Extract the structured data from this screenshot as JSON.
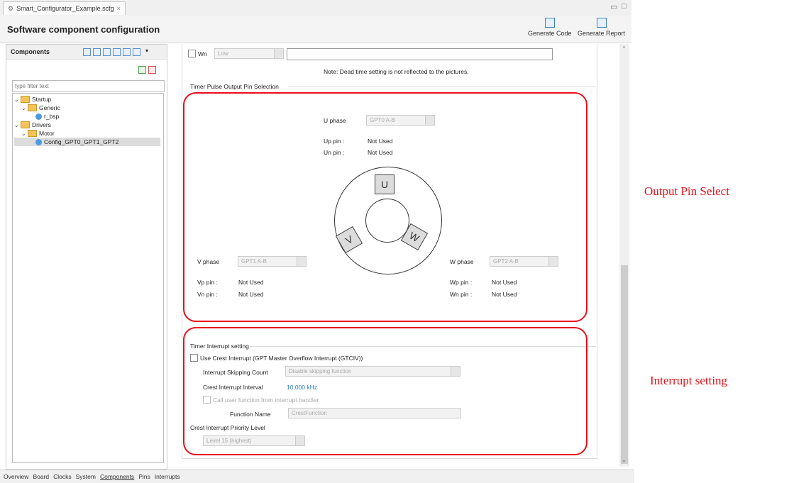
{
  "editor": {
    "tab_label": "Smart_Configurator_Example.scfg",
    "tab_close": "×",
    "page_title": "Software component configuration",
    "generate_code": "Generate Code",
    "generate_report": "Generate Report"
  },
  "components_panel": {
    "title": "Components",
    "filter_placeholder": "type filter text",
    "tree": [
      {
        "label": "Startup",
        "kind": "folder",
        "level": 0
      },
      {
        "label": "Generic",
        "kind": "folder",
        "level": 1
      },
      {
        "label": "r_bsp",
        "kind": "component",
        "level": 2
      },
      {
        "label": "Drivers",
        "kind": "folder",
        "level": 0
      },
      {
        "label": "Motor",
        "kind": "folder",
        "level": 1
      },
      {
        "label": "Config_GPT0_GPT1_GPT2",
        "kind": "component",
        "level": 2,
        "selected": true
      }
    ]
  },
  "deadtime": {
    "wn_label": "Wn",
    "wn_value": "Low",
    "note": "Note: Dead time setting is not reflected to the pictures."
  },
  "pin_selection": {
    "section_title": "Timer Pulse Output Pin Selection",
    "u": {
      "phase_label": "U phase",
      "value": "GPT0 A-B",
      "p_label": "Up pin :",
      "p_value": "Not Used",
      "n_label": "Un pin :",
      "n_value": "Not Used"
    },
    "v": {
      "phase_label": "V phase",
      "value": "GPT1 A-B",
      "p_label": "Vp pin :",
      "p_value": "Not Used",
      "n_label": "Vn pin :",
      "n_value": "Not Used"
    },
    "w": {
      "phase_label": "W phase",
      "value": "GPT2 A-B",
      "p_label": "Wp pin :",
      "p_value": "Not Used",
      "n_label": "Wn pin :",
      "n_value": "Not Used"
    },
    "diagram_labels": {
      "u": "U",
      "v": "V",
      "w": "W"
    }
  },
  "interrupt": {
    "section_title": "Timer Interrupt setting",
    "crest_checkbox": "Use Crest Interrupt (GPT Master Overflow Interrupt (GTCIV))",
    "skip_label": "Interrupt Skipping Count",
    "skip_value": "Disable skipping function",
    "interval_label": "Crest Interrupt Interval",
    "interval_value": "10.000 kHz",
    "callback_checkbox": "Call user function from interrupt handler",
    "function_label": "Function Name",
    "function_value": "CrestFunction",
    "priority_label": "Crest Interrupt Priority Level",
    "priority_value": "Level 15 (highest)"
  },
  "annotations": {
    "output_pin": "Output Pin Select",
    "interrupt": "Interrupt setting",
    "color": "#e8101a"
  },
  "bottom_tabs": [
    "Overview",
    "Board",
    "Clocks",
    "System",
    "Components",
    "Pins",
    "Interrupts"
  ],
  "bottom_tabs_active": "Components"
}
